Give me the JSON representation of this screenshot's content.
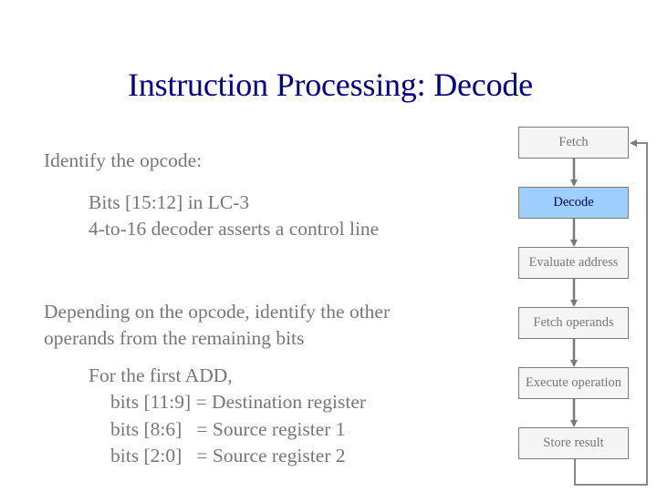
{
  "slide": {
    "title": "Instruction Processing: Decode",
    "bullets": {
      "identify": "Identify the opcode:",
      "bits": "Bits [15:12] in LC-3",
      "decoder": "4-to-16 decoder asserts a control line",
      "depending_line1": "Depending on the opcode, identify the other",
      "depending_line2": "operands from the remaining bits",
      "first_add": "For the first ADD,",
      "dest": "bits [11:9] = Destination register",
      "src1": "bits [8:6]   = Source register 1",
      "src2": "bits [2:0]   = Source register 2"
    }
  },
  "pipeline": {
    "stages": [
      {
        "label": "Fetch",
        "active": false
      },
      {
        "label": "Decode",
        "active": true
      },
      {
        "label": "Evaluate address",
        "active": false
      },
      {
        "label": "Fetch operands",
        "active": false
      },
      {
        "label": "Execute operation",
        "active": false
      },
      {
        "label": "Store result",
        "active": false
      }
    ],
    "loop_back_to": "Fetch",
    "colors": {
      "active_fill": "#9ecfff",
      "active_text": "#000066",
      "inactive_fill": "#f5f5f5",
      "inactive_text": "#777777",
      "border": "#7a7a7a"
    }
  },
  "colors": {
    "title": "#000080",
    "body_text": "#777777"
  }
}
